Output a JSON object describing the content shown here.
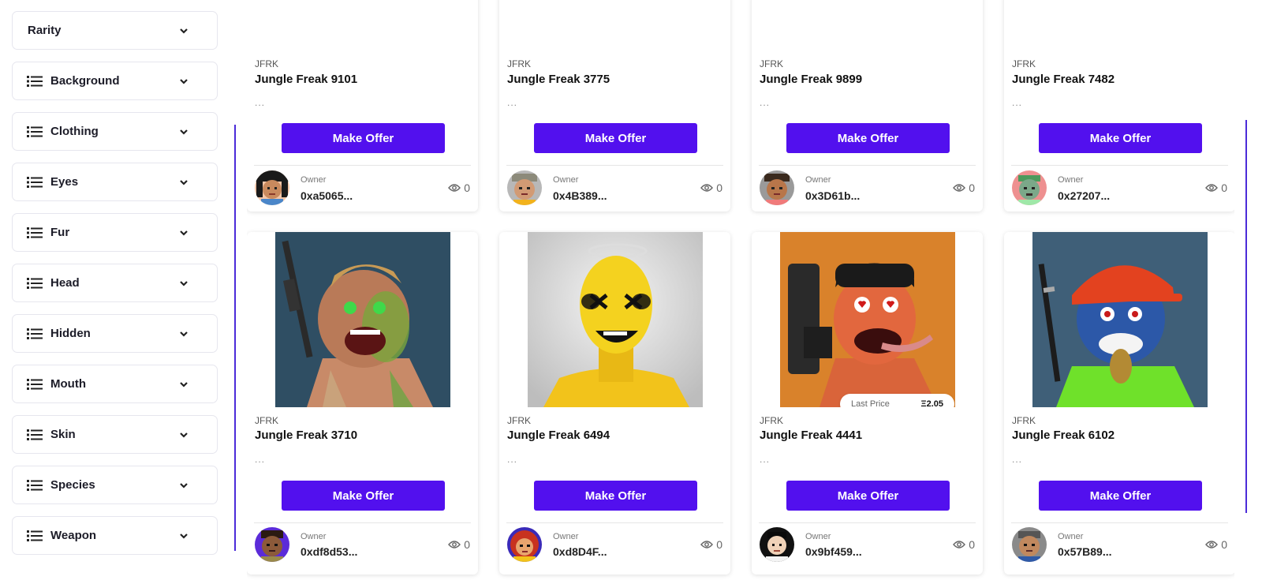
{
  "sidebar": {
    "filters": [
      {
        "label": "Rarity",
        "icon": "none"
      },
      {
        "label": "Background",
        "icon": "list-icon"
      },
      {
        "label": "Clothing",
        "icon": "list-icon"
      },
      {
        "label": "Eyes",
        "icon": "list-icon"
      },
      {
        "label": "Fur",
        "icon": "list-icon"
      },
      {
        "label": "Head",
        "icon": "list-icon"
      },
      {
        "label": "Hidden",
        "icon": "list-icon"
      },
      {
        "label": "Mouth",
        "icon": "list-icon"
      },
      {
        "label": "Skin",
        "icon": "list-icon"
      },
      {
        "label": "Species",
        "icon": "list-icon"
      },
      {
        "label": "Weapon",
        "icon": "list-icon"
      }
    ]
  },
  "cards": [
    {
      "collection": "JFRK",
      "name": "Jungle Freak 9101",
      "desc": "...",
      "button": "Make Offer",
      "owner_label": "Owner",
      "owner": "0xa5065...",
      "views": "0"
    },
    {
      "collection": "JFRK",
      "name": "Jungle Freak 3775",
      "desc": "...",
      "button": "Make Offer",
      "owner_label": "Owner",
      "owner": "0x4B389...",
      "views": "0"
    },
    {
      "collection": "JFRK",
      "name": "Jungle Freak 9899",
      "desc": "...",
      "button": "Make Offer",
      "owner_label": "Owner",
      "owner": "0x3D61b...",
      "views": "0"
    },
    {
      "collection": "JFRK",
      "name": "Jungle Freak 7482",
      "desc": "...",
      "button": "Make Offer",
      "owner_label": "Owner",
      "owner": "0x27207...",
      "views": "0"
    },
    {
      "collection": "JFRK",
      "name": "Jungle Freak 3710",
      "desc": "...",
      "button": "Make Offer",
      "owner_label": "Owner",
      "owner": "0xdf8d53...",
      "views": "0"
    },
    {
      "collection": "JFRK",
      "name": "Jungle Freak 6494",
      "desc": "...",
      "button": "Make Offer",
      "owner_label": "Owner",
      "owner": "0xd8D4F...",
      "views": "0"
    },
    {
      "collection": "JFRK",
      "name": "Jungle Freak 4441",
      "desc": "...",
      "button": "Make Offer",
      "owner_label": "Owner",
      "owner": "0x9bf459...",
      "views": "0",
      "last_price_label": "Last Price",
      "last_price": "Ξ2.05"
    },
    {
      "collection": "JFRK",
      "name": "Jungle Freak 6102",
      "desc": "...",
      "button": "Make Offer",
      "owner_label": "Owner",
      "owner": "0x57B89...",
      "views": "0"
    }
  ],
  "colors": {
    "accent": "#5210ee",
    "line": "#4b2bd8"
  }
}
